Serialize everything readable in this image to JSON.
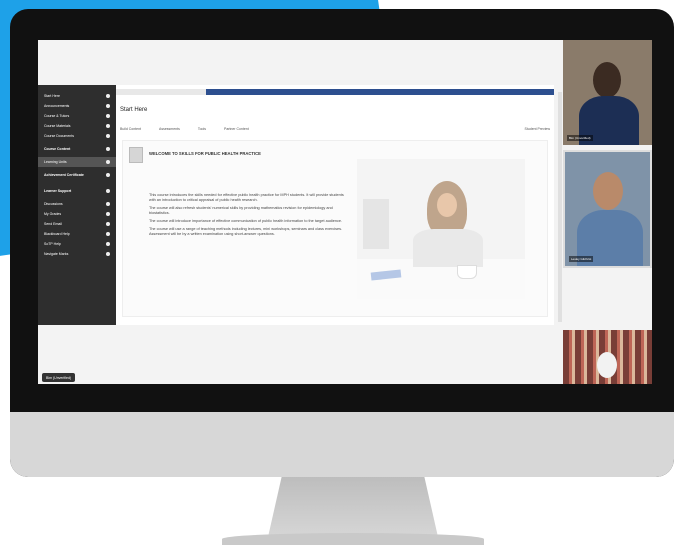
{
  "lms": {
    "page_title": "Start Here",
    "sidebar": {
      "items": [
        "Start Here",
        "Announcements",
        "Course & Tutors",
        "Course Materials",
        "Course Documents",
        "Course Content",
        "Learning Units",
        "Achievement Certificate",
        "Learner Support",
        "Discussions",
        "My Grades",
        "Send Email",
        "Blackboard Help",
        "SoTP Help",
        "Navigate Marks"
      ]
    },
    "menu": [
      "Build Content",
      "Assessments",
      "Tools",
      "Partner Content"
    ],
    "menu_right": "Student Preview",
    "content": {
      "welcome_title": "WELCOME TO SKILLS FOR PUBLIC HEALTH PRACTICE",
      "paragraphs": [
        "This course introduces the skills needed for effective public health practice for MPH students. It will provide students with an introduction to critical appraisal of public health research.",
        "The course will also refresh students' numerical skills by providing mathematics revision for epidemiology and biostatistics.",
        "The course will introduce importance of effective communication of public health information to the target audience.",
        "The course will use a range of teaching methods including lectures, mini workshops, seminars and class exercises. Assessment will be by a written examination using short-answer questions."
      ]
    }
  },
  "meeting": {
    "presenter_name": "Bim (Unverified)",
    "participants": [
      {
        "label": "Bim (Unverified)"
      },
      {
        "label": "Lesley Gilchrist"
      },
      {
        "label": ""
      }
    ]
  },
  "colors": {
    "accent_blue": "#1ea1e8",
    "lms_topbar": "#2d4f8f",
    "sidebar_bg": "#2e2e2e"
  }
}
